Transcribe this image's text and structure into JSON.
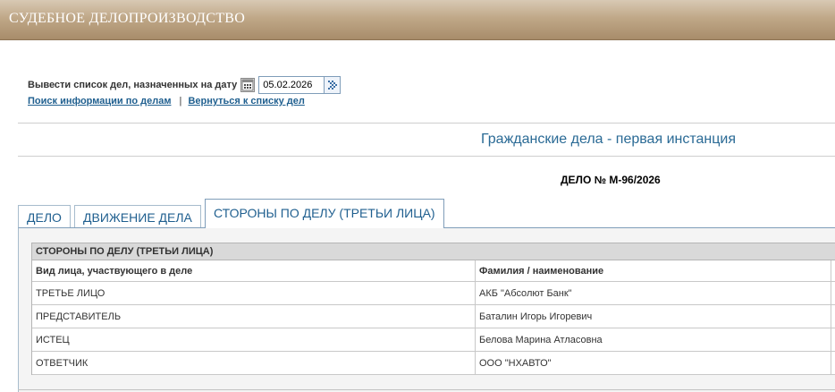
{
  "header": {
    "title": "СУДЕБНОЕ ДЕЛОПРОИЗВОДСТВО"
  },
  "date_filter": {
    "label": "Вывести список дел, назначенных на дату",
    "value": "05.02.2026"
  },
  "links": {
    "search": "Поиск информации по делам",
    "separator": "|",
    "back": "Вернуться к списку дел"
  },
  "section_title": "Гражданские дела - первая инстанция",
  "case_number": "ДЕЛО № М-96/2026",
  "tabs": [
    {
      "label": "ДЕЛО",
      "active": false
    },
    {
      "label": "ДВИЖЕНИЕ ДЕЛА",
      "active": false
    },
    {
      "label": "СТОРОНЫ ПО ДЕЛУ (ТРЕТЬИ ЛИЦА)",
      "active": true
    }
  ],
  "parties_table": {
    "title": "СТОРОНЫ ПО ДЕЛУ (ТРЕТЬИ ЛИЦА)",
    "columns": [
      "Вид лица, участвующего в деле",
      "Фамилия / наименование"
    ],
    "rows": [
      {
        "role": "ТРЕТЬЕ ЛИЦО",
        "name": "АКБ \"Абсолют Банк\""
      },
      {
        "role": "ПРЕДСТАВИТЕЛЬ",
        "name": "Баталин Игорь Игоревич"
      },
      {
        "role": "ИСТЕЦ",
        "name": "Белова Марина Атласовна"
      },
      {
        "role": "ОТВЕТЧИК",
        "name": "ООО \"НХАВТО\""
      }
    ]
  },
  "icons": {
    "calendar": "calendar-icon",
    "go": "go-arrow-icon"
  },
  "colors": {
    "header_bg": "#b89c7a",
    "link": "#1f5f8f",
    "section_title": "#2a6a95",
    "tab_border": "#7f9db9"
  }
}
